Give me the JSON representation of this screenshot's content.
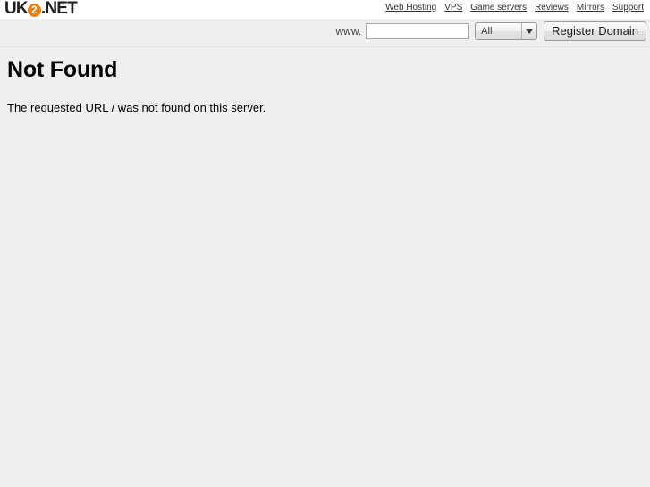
{
  "brand": {
    "logo_prefix": "UK",
    "logo_badge": "2",
    "logo_suffix": ".NET",
    "logo_badge_color": "#f07f10",
    "logo_text_color": "#231f20"
  },
  "top_nav": {
    "items": [
      {
        "label": "Web Hosting"
      },
      {
        "label": "VPS"
      },
      {
        "label": "Game servers"
      },
      {
        "label": "Reviews"
      },
      {
        "label": "Mirrors"
      },
      {
        "label": "Support"
      }
    ]
  },
  "domain_search": {
    "prefix_label": "www.",
    "input_value": "",
    "input_placeholder": "",
    "tld_selected": "All",
    "tld_options": [
      "All"
    ],
    "submit_label": "Register Domain",
    "dropdown_icon": "chevron-down-icon"
  },
  "main": {
    "title": "Not Found",
    "message": "The requested URL / was not found on this server."
  },
  "colors": {
    "page_background": "#efefef",
    "header_background": "#ffffff",
    "accent": "#f07f10",
    "text": "#000000"
  }
}
